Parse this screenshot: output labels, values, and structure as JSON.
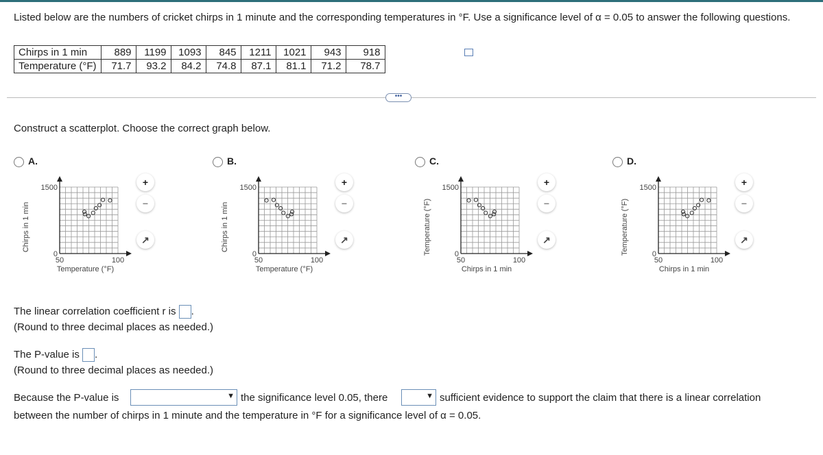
{
  "question": {
    "intro": "Listed below are the numbers of cricket chirps in 1 minute and the corresponding temperatures in °F. Use a significance level of α = 0.05 to answer the following questions.",
    "table": {
      "row1_label": "Chirps in 1 min",
      "row2_label": "Temperature (°F)",
      "chirps": [
        "889",
        "1199",
        "1093",
        "845",
        "1211",
        "1021",
        "943",
        "918"
      ],
      "temps": [
        "71.7",
        "93.2",
        "84.2",
        "74.8",
        "87.1",
        "81.1",
        "71.2",
        "78.7"
      ]
    },
    "more": "•••",
    "construct": "Construct a scatterplot. Choose the correct graph below."
  },
  "options": [
    {
      "label": "A.",
      "xlabel": "Temperature (°F)",
      "ylabel": "Chirps in 1 min",
      "xticks": [
        "50",
        "100"
      ],
      "yticks": [
        "0",
        "1500"
      ],
      "points": [
        [
          71.7,
          889
        ],
        [
          93.2,
          1199
        ],
        [
          84.2,
          1093
        ],
        [
          74.8,
          845
        ],
        [
          87.1,
          1211
        ],
        [
          81.1,
          1021
        ],
        [
          71.2,
          943
        ],
        [
          78.7,
          918
        ]
      ]
    },
    {
      "label": "B.",
      "xlabel": "Temperature (°F)",
      "ylabel": "Chirps in 1 min",
      "xticks": [
        "50",
        "100"
      ],
      "yticks": [
        "0",
        "1500"
      ],
      "points": [
        [
          78.3,
          889
        ],
        [
          56.8,
          1199
        ],
        [
          65.8,
          1093
        ],
        [
          75.2,
          845
        ],
        [
          62.9,
          1211
        ],
        [
          68.9,
          1021
        ],
        [
          78.8,
          943
        ],
        [
          71.3,
          918
        ]
      ]
    },
    {
      "label": "C.",
      "xlabel": "Chirps in 1 min",
      "ylabel": "Temperature (°F)",
      "xticks": [
        "50",
        "100"
      ],
      "yticks": [
        "0",
        "1500"
      ],
      "points": [
        [
          78.3,
          889
        ],
        [
          56.8,
          1199
        ],
        [
          65.8,
          1093
        ],
        [
          75.2,
          845
        ],
        [
          62.9,
          1211
        ],
        [
          68.9,
          1021
        ],
        [
          78.8,
          943
        ],
        [
          71.3,
          918
        ]
      ]
    },
    {
      "label": "D.",
      "xlabel": "Chirps in 1 min",
      "ylabel": "Temperature (°F)",
      "xticks": [
        "50",
        "100"
      ],
      "yticks": [
        "0",
        "1500"
      ],
      "points": [
        [
          71.7,
          889
        ],
        [
          93.2,
          1199
        ],
        [
          84.2,
          1093
        ],
        [
          74.8,
          845
        ],
        [
          87.1,
          1211
        ],
        [
          81.1,
          1021
        ],
        [
          71.2,
          943
        ],
        [
          78.7,
          918
        ]
      ]
    }
  ],
  "r": {
    "text": "The linear correlation coefficient r is",
    "note": "(Round to three decimal places as needed.)"
  },
  "p": {
    "text": "The P-value is",
    "note": "(Round to three decimal places as needed.)"
  },
  "conclusion": {
    "part1": "Because the P-value is",
    "part2": "the significance level 0.05, there",
    "part3": "sufficient evidence to support the claim that there is a linear correlation",
    "line2": "between the number of chirps in 1 minute and the temperature in °F for a significance level of α = 0.05."
  }
}
